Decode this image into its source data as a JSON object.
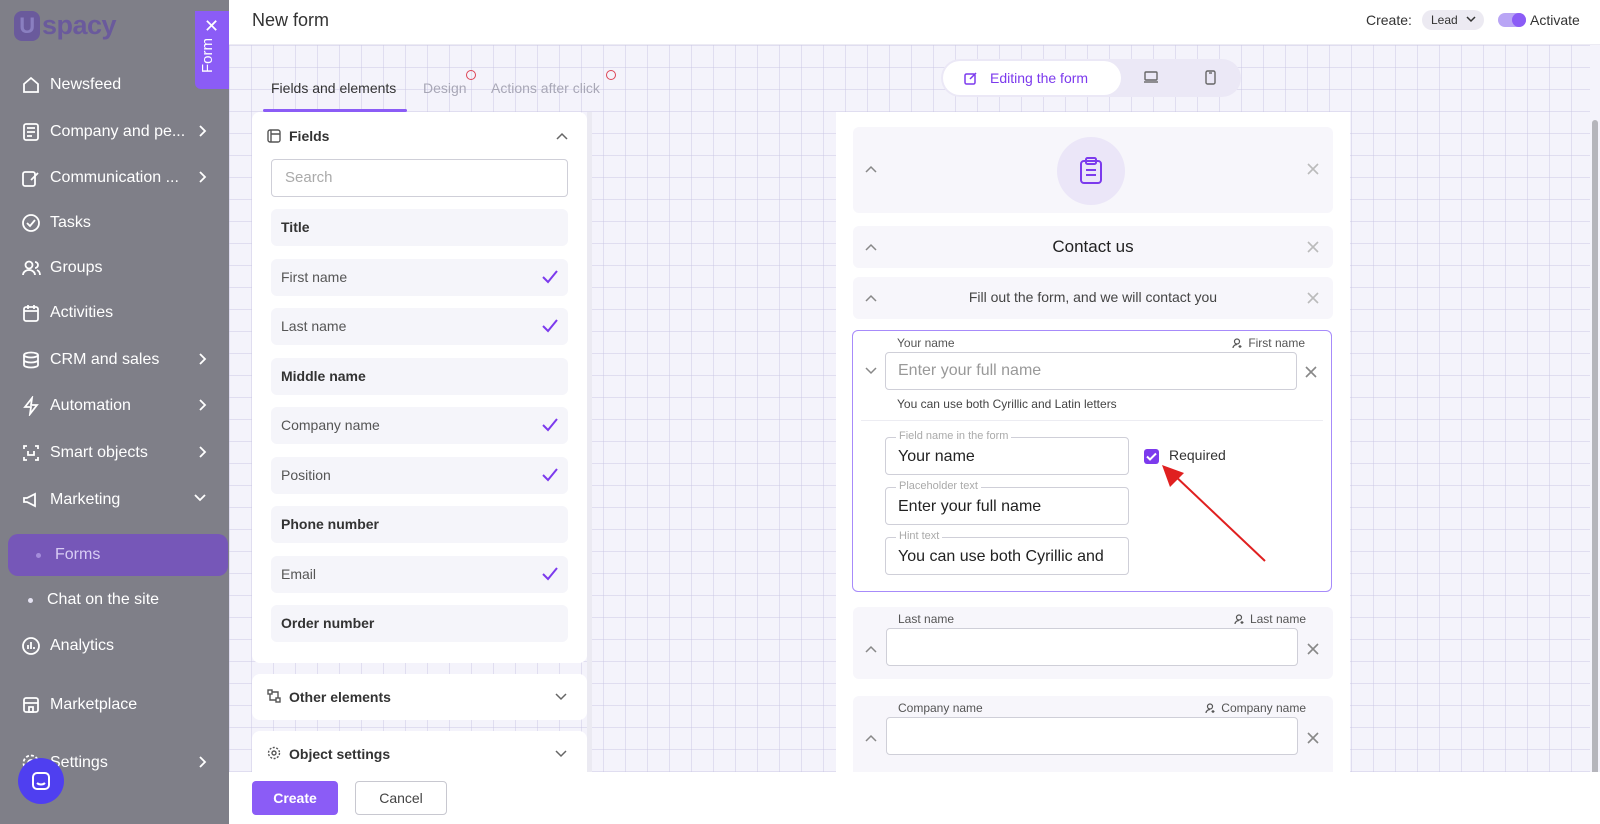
{
  "brand": {
    "name": "spacy",
    "letter": "U"
  },
  "sidebar": {
    "items": [
      {
        "label": "Newsfeed",
        "icon": "home-icon"
      },
      {
        "label": "Company and pe...",
        "icon": "book-icon"
      },
      {
        "label": "Communication ...",
        "icon": "pen-icon"
      },
      {
        "label": "Tasks",
        "icon": "check-circle-icon"
      },
      {
        "label": "Groups",
        "icon": "users-icon"
      },
      {
        "label": "Activities",
        "icon": "calendar-icon"
      },
      {
        "label": "CRM and sales",
        "icon": "database-icon"
      },
      {
        "label": "Automation",
        "icon": "bolt-icon"
      },
      {
        "label": "Smart objects",
        "icon": "smart-object-icon"
      },
      {
        "label": "Marketing",
        "icon": "megaphone-icon"
      },
      {
        "label": "Forms",
        "icon": "dot-icon"
      },
      {
        "label": "Chat on the site",
        "icon": "dot-icon"
      },
      {
        "label": "Analytics",
        "icon": "chart-icon"
      },
      {
        "label": "Marketplace",
        "icon": "store-icon"
      },
      {
        "label": "Settings",
        "icon": "gear-icon"
      }
    ],
    "form_tab": "Form"
  },
  "header": {
    "title": "New form",
    "create_label": "Create:",
    "create_value": "Lead",
    "activate_label": "Activate"
  },
  "tabs": [
    {
      "label": "Fields and elements",
      "active": true
    },
    {
      "label": "Design",
      "active": false
    },
    {
      "label": "Actions after click",
      "active": false
    }
  ],
  "toolbar": {
    "editing_label": "Editing the form"
  },
  "fields_panel": {
    "title": "Fields",
    "search_placeholder": "Search",
    "items": [
      {
        "label": "Title",
        "checked": false
      },
      {
        "label": "First name",
        "checked": true
      },
      {
        "label": "Last name",
        "checked": true
      },
      {
        "label": "Middle name",
        "checked": false
      },
      {
        "label": "Company name",
        "checked": true
      },
      {
        "label": "Position",
        "checked": true
      },
      {
        "label": "Phone number",
        "checked": false
      },
      {
        "label": "Email",
        "checked": true
      },
      {
        "label": "Order number",
        "checked": false
      }
    ]
  },
  "other_elements": {
    "title": "Other elements"
  },
  "object_settings": {
    "title": "Object settings"
  },
  "form_preview": {
    "title": "Contact us",
    "subtitle": "Fill out the form, and we will contact you",
    "your_name": {
      "label": "Your name",
      "mapped": "First name",
      "placeholder": "Enter your full name",
      "hint": "You can use both Cyrillic and Latin letters",
      "settings": {
        "field_name_legend": "Field name in the form",
        "field_name_value": "Your name",
        "placeholder_legend": "Placeholder text",
        "placeholder_value": "Enter your full name",
        "hint_legend": "Hint text",
        "hint_value": "You can use both Cyrillic and",
        "required_label": "Required",
        "required": true
      }
    },
    "last_name": {
      "label": "Last name",
      "mapped": "Last name"
    },
    "company_name": {
      "label": "Company name",
      "mapped": "Company name"
    }
  },
  "footer": {
    "create": "Create",
    "cancel": "Cancel"
  },
  "colors": {
    "accent": "#8b5cf6",
    "sidebar": "#7f7f88",
    "annotation_arrow": "#e02020"
  }
}
